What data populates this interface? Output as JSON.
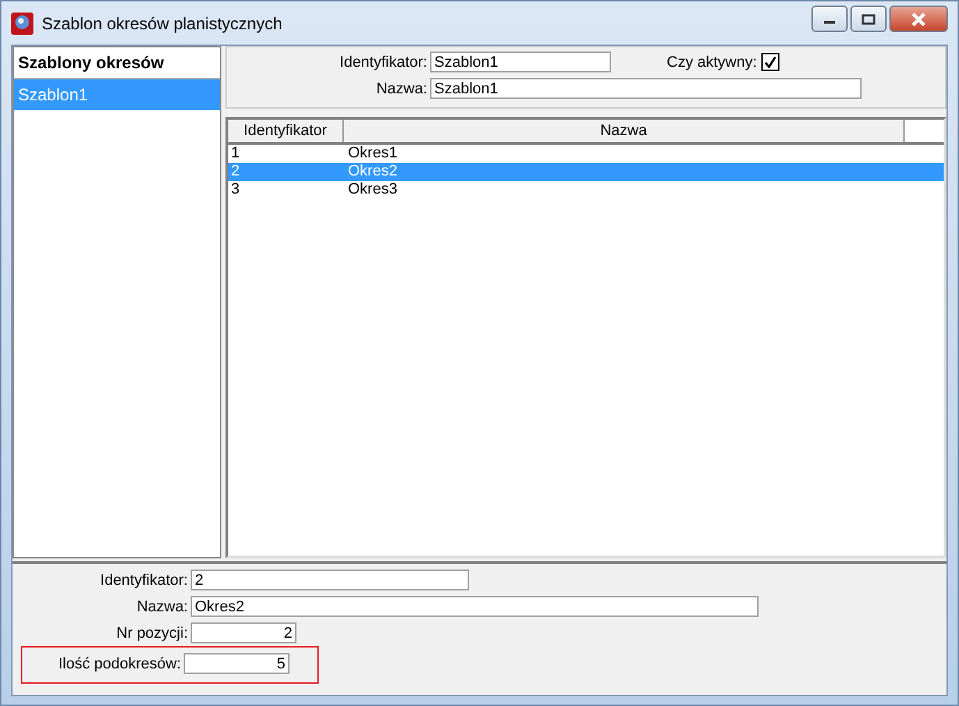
{
  "window": {
    "title": "Szablon okresów planistycznych"
  },
  "sidebar": {
    "title": "Szablony okresów",
    "items": [
      {
        "label": "Szablon1",
        "selected": true
      }
    ]
  },
  "header_form": {
    "identifier_label": "Identyfikator:",
    "identifier_value": "Szablon1",
    "active_label": "Czy aktywny:",
    "active_checked": true,
    "name_label": "Nazwa:",
    "name_value": "Szablon1"
  },
  "table": {
    "columns": [
      "Identyfikator",
      "Nazwa"
    ],
    "rows": [
      {
        "cells": [
          "1",
          "Okres1"
        ],
        "selected": false
      },
      {
        "cells": [
          "2",
          "Okres2"
        ],
        "selected": true
      },
      {
        "cells": [
          "3",
          "Okres3"
        ],
        "selected": false
      }
    ]
  },
  "detail_form": {
    "fields": [
      {
        "label": "Identyfikator:",
        "value": "2",
        "kind": "medium",
        "highlighted": false
      },
      {
        "label": "Nazwa:",
        "value": "Okres2",
        "kind": "wide",
        "highlighted": false
      },
      {
        "label": "Nr pozycji:",
        "value": "2",
        "kind": "number",
        "highlighted": false
      },
      {
        "label": "Ilość podokresów:",
        "value": "5",
        "kind": "number",
        "highlighted": true
      }
    ]
  }
}
